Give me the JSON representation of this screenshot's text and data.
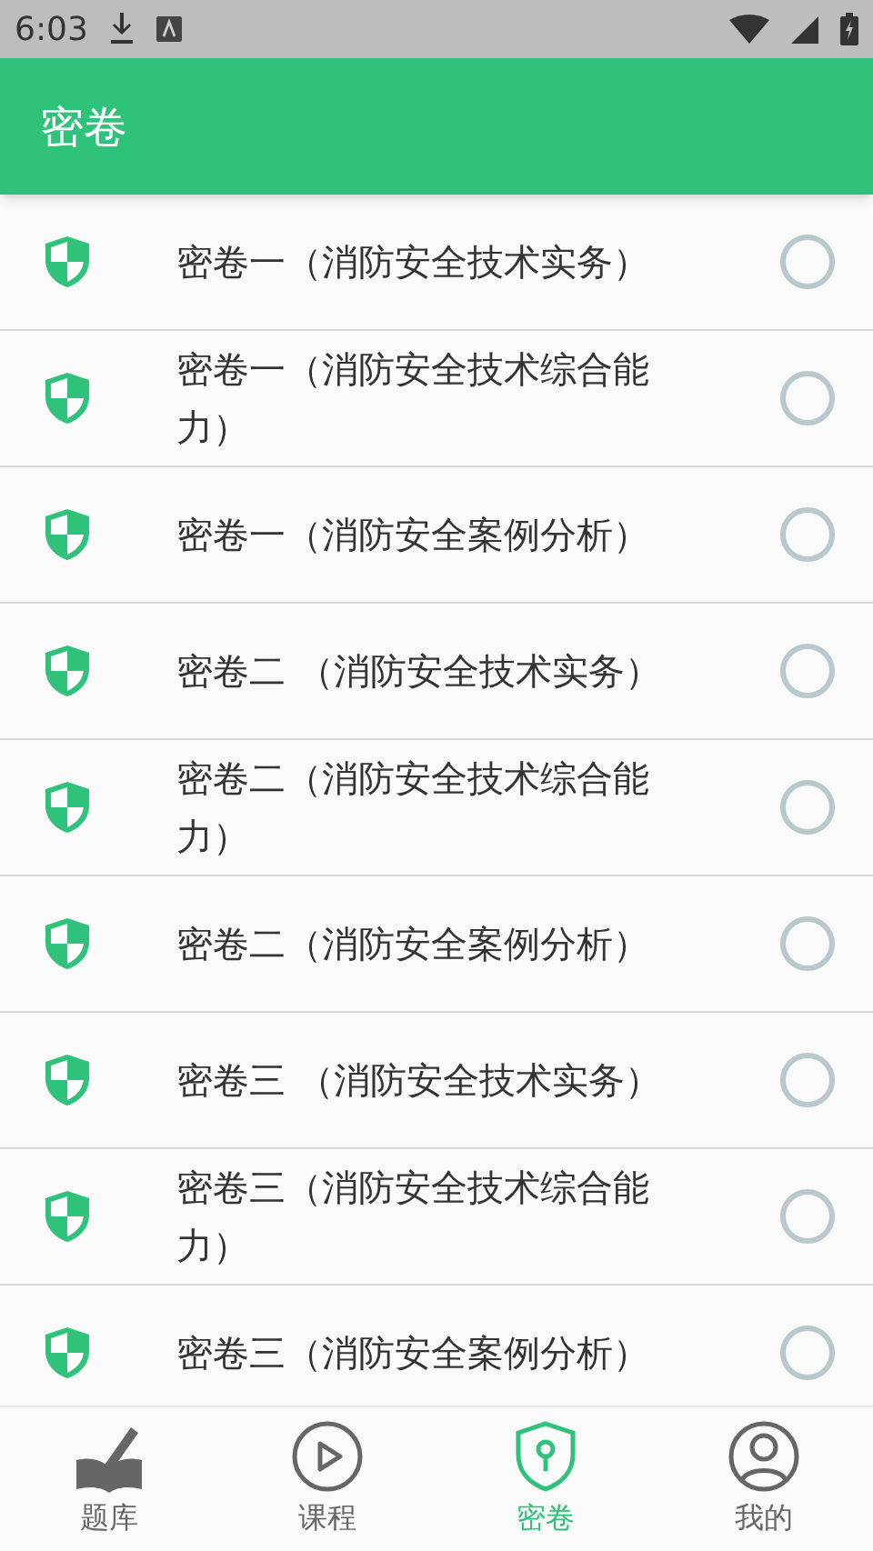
{
  "status_bar": {
    "time": "6:03"
  },
  "app_bar": {
    "title": "密卷"
  },
  "papers": [
    {
      "title": "密卷一（消防安全技术实务）",
      "selected": false
    },
    {
      "title": "密卷一（消防安全技术综合能力）",
      "selected": false
    },
    {
      "title": "密卷一（消防安全案例分析）",
      "selected": false
    },
    {
      "title": "密卷二 （消防安全技术实务）",
      "selected": false
    },
    {
      "title": "密卷二（消防安全技术综合能力）",
      "selected": false
    },
    {
      "title": "密卷二（消防安全案例分析）",
      "selected": false
    },
    {
      "title": "密卷三 （消防安全技术实务）",
      "selected": false
    },
    {
      "title": "密卷三（消防安全技术综合能力）",
      "selected": false
    },
    {
      "title": "密卷三（消防安全案例分析）",
      "selected": false
    }
  ],
  "bottom_nav": [
    {
      "kind": "bank",
      "label": "题库",
      "selected": false
    },
    {
      "kind": "course",
      "label": "课程",
      "selected": false
    },
    {
      "kind": "secret",
      "label": "密卷",
      "selected": true
    },
    {
      "kind": "profile",
      "label": "我的",
      "selected": false
    }
  ]
}
